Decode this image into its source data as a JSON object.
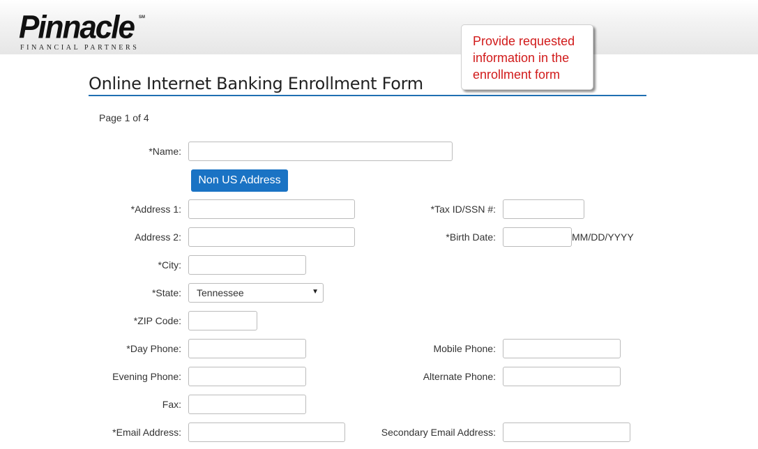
{
  "header": {
    "logo_text": "Pinnacle",
    "logo_mark": "SM",
    "logo_subtext": "FINANCIAL PARTNERS"
  },
  "callout": {
    "text": "Provide requested information in the enrollment form"
  },
  "form": {
    "title": "Online Internet Banking Enrollment Form",
    "page_indicator": "Page 1 of 4",
    "non_us_button": "Non US Address",
    "birth_date_format": "MM/DD/YYYY",
    "state_value": "Tennessee",
    "labels": {
      "name": "*Name:",
      "address1": "*Address 1:",
      "address2": "Address 2:",
      "city": "*City:",
      "state": "*State:",
      "zip": "*ZIP Code:",
      "day_phone": "*Day Phone:",
      "evening_phone": "Evening Phone:",
      "fax": "Fax:",
      "email": "*Email Address:",
      "tax_id": "*Tax ID/SSN #:",
      "birth_date": "*Birth Date:",
      "mobile_phone": "Mobile Phone:",
      "alternate_phone": "Alternate Phone:",
      "secondary_email": "Secondary Email Address:"
    },
    "values": {
      "name": "",
      "address1": "",
      "address2": "",
      "city": "",
      "zip": "",
      "day_phone": "",
      "evening_phone": "",
      "fax": "",
      "email": "",
      "tax_id": "",
      "birth_date": "",
      "mobile_phone": "",
      "alternate_phone": "",
      "secondary_email": ""
    }
  },
  "colors": {
    "accent_blue": "#1a73c4",
    "callout_text": "#d11a1a",
    "title_rule": "#1f6fb2"
  }
}
